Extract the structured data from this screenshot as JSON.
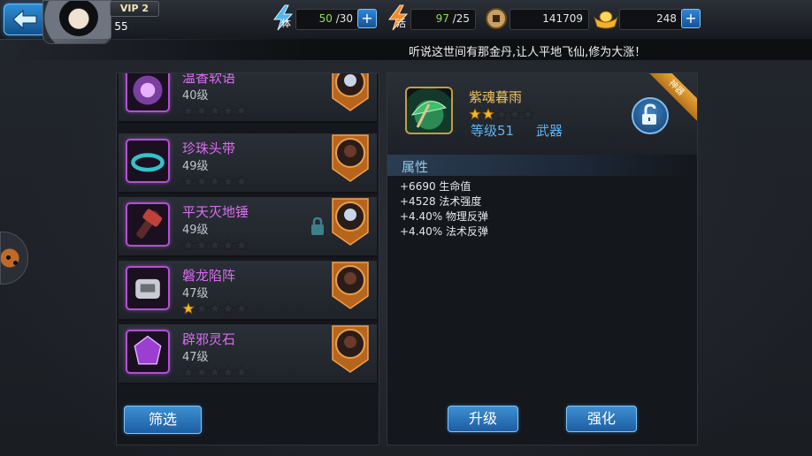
{
  "header": {
    "vip": "VIP 2",
    "player_level": "55",
    "stamina": {
      "label": "体",
      "current": "50",
      "max": "/30"
    },
    "vitality": {
      "label": "活",
      "current": "97",
      "max": "/25"
    },
    "coins": "141709",
    "gold": "248",
    "plus": "+"
  },
  "ticker": "听说这世间有那金丹,让人平地飞仙,修为大涨！",
  "items": [
    {
      "name": "温香软语",
      "level": "40级",
      "stars": 0,
      "locked": false
    },
    {
      "name": "珍珠头带",
      "level": "49级",
      "stars": 0,
      "locked": false
    },
    {
      "name": "平天灭地锤",
      "level": "49级",
      "stars": 0,
      "locked": true
    },
    {
      "name": "磐龙陷阵",
      "level": "47级",
      "stars": 1,
      "locked": false
    },
    {
      "name": "辟邪灵石",
      "level": "47级",
      "stars": 0,
      "locked": false
    }
  ],
  "filter_button": "筛选",
  "detail": {
    "name": "紫魂暮雨",
    "stars": 2,
    "level": "等级51",
    "type": "武器",
    "ribbon": "神器",
    "attributes_title": "属性",
    "attributes": [
      "+6690 生命值",
      "+4528 法术强度",
      "+4.40% 物理反弹",
      "+4.40% 法术反弹"
    ],
    "upgrade_button": "升级",
    "enhance_button": "强化"
  },
  "colors": {
    "item_name": "#d96cf0",
    "detail_name": "#f0c25a",
    "accent_blue": "#5fb4f0",
    "star_gold": "#f5b82a"
  }
}
